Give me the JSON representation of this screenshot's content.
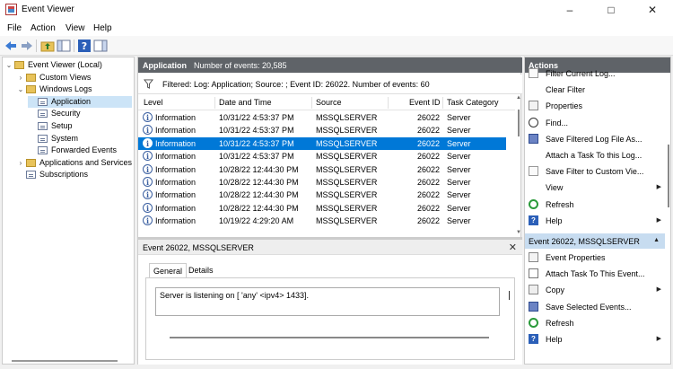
{
  "window": {
    "title": "Event Viewer"
  },
  "menu": [
    "File",
    "Action",
    "View",
    "Help"
  ],
  "tree": {
    "items": [
      {
        "label": "Event Viewer (Local)",
        "indent": 0,
        "expander": "⌄",
        "icon": "folder"
      },
      {
        "label": "Custom Views",
        "indent": 1,
        "expander": "›",
        "icon": "folder"
      },
      {
        "label": "Windows Logs",
        "indent": 1,
        "expander": "⌄",
        "icon": "folder"
      },
      {
        "label": "Application",
        "indent": 2,
        "expander": "",
        "icon": "log",
        "selected": true
      },
      {
        "label": "Security",
        "indent": 2,
        "expander": "",
        "icon": "log"
      },
      {
        "label": "Setup",
        "indent": 2,
        "expander": "",
        "icon": "log"
      },
      {
        "label": "System",
        "indent": 2,
        "expander": "",
        "icon": "log"
      },
      {
        "label": "Forwarded Events",
        "indent": 2,
        "expander": "",
        "icon": "log"
      },
      {
        "label": "Applications and Services Lo",
        "indent": 1,
        "expander": "›",
        "icon": "folder"
      },
      {
        "label": "Subscriptions",
        "indent": 1,
        "expander": "",
        "icon": "log"
      }
    ]
  },
  "center": {
    "log_name": "Application",
    "event_count": "Number of events: 20,585",
    "filter_text": "Filtered: Log: Application; Source: ; Event ID: 26022. Number of events: 60",
    "columns": [
      "Level",
      "Date and Time",
      "Source",
      "Event ID",
      "Task Category"
    ],
    "rows": [
      {
        "level": "Information",
        "date": "10/31/22 4:53:37 PM",
        "source": "MSSQLSERVER",
        "id": "26022",
        "cat": "Server"
      },
      {
        "level": "Information",
        "date": "10/31/22 4:53:37 PM",
        "source": "MSSQLSERVER",
        "id": "26022",
        "cat": "Server"
      },
      {
        "level": "Information",
        "date": "10/31/22 4:53:37 PM",
        "source": "MSSQLSERVER",
        "id": "26022",
        "cat": "Server",
        "selected": true
      },
      {
        "level": "Information",
        "date": "10/31/22 4:53:37 PM",
        "source": "MSSQLSERVER",
        "id": "26022",
        "cat": "Server"
      },
      {
        "level": "Information",
        "date": "10/28/22 12:44:30 PM",
        "source": "MSSQLSERVER",
        "id": "26022",
        "cat": "Server"
      },
      {
        "level": "Information",
        "date": "10/28/22 12:44:30 PM",
        "source": "MSSQLSERVER",
        "id": "26022",
        "cat": "Server"
      },
      {
        "level": "Information",
        "date": "10/28/22 12:44:30 PM",
        "source": "MSSQLSERVER",
        "id": "26022",
        "cat": "Server"
      },
      {
        "level": "Information",
        "date": "10/28/22 12:44:30 PM",
        "source": "MSSQLSERVER",
        "id": "26022",
        "cat": "Server"
      },
      {
        "level": "Information",
        "date": "10/19/22 4:29:20 AM",
        "source": "MSSQLSERVER",
        "id": "26022",
        "cat": "Server"
      }
    ]
  },
  "detail": {
    "title": "Event 26022, MSSQLSERVER",
    "tabs": [
      "General",
      "Details"
    ],
    "message": "Server is listening on [ 'any' <ipv4> 1433]."
  },
  "actions": {
    "title": "Actions",
    "log_actions": [
      {
        "label": "Filter Current Log...",
        "icon": "filter"
      },
      {
        "label": "Clear Filter",
        "icon": ""
      },
      {
        "label": "Properties",
        "icon": "props"
      },
      {
        "label": "Find...",
        "icon": "find"
      },
      {
        "label": "Save Filtered Log File As...",
        "icon": "save"
      },
      {
        "label": "Attach a Task To this Log...",
        "icon": ""
      },
      {
        "label": "Save Filter to Custom Vie...",
        "icon": "filter"
      },
      {
        "label": "View",
        "icon": "",
        "submenu": true
      },
      {
        "label": "Refresh",
        "icon": "refresh"
      },
      {
        "label": "Help",
        "icon": "help",
        "submenu": true
      }
    ],
    "event_section": "Event 26022, MSSQLSERVER",
    "event_actions": [
      {
        "label": "Event Properties",
        "icon": "props"
      },
      {
        "label": "Attach Task To This Event...",
        "icon": "task"
      },
      {
        "label": "Copy",
        "icon": "copy",
        "submenu": true
      },
      {
        "label": "Save Selected Events...",
        "icon": "save"
      },
      {
        "label": "Refresh",
        "icon": "refresh"
      },
      {
        "label": "Help",
        "icon": "help",
        "submenu": true
      }
    ]
  }
}
